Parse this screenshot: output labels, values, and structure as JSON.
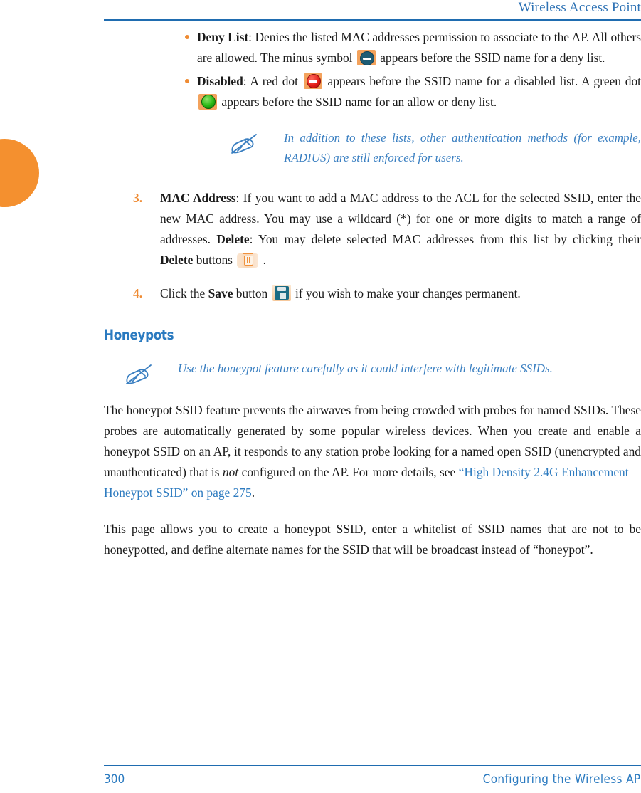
{
  "header": {
    "title": "Wireless Access Point",
    "rule_color": "#1f6cb0"
  },
  "edge_tab": {
    "color": "#f4902f"
  },
  "bullets": [
    {
      "term": "Deny List",
      "text_before": ": Denies the listed MAC addresses permission to associate to the AP. All others are allowed. The minus symbol",
      "icon": "minus-circle-icon",
      "text_after": "appears before the SSID name for a deny list."
    },
    {
      "term": "Disabled",
      "text_before": ": A red dot",
      "icon": "red-dot-icon",
      "text_mid": "appears before the SSID name for a disabled list. A green dot",
      "icon2": "green-dot-icon",
      "text_after": "appears before the SSID name for an allow or deny list."
    }
  ],
  "note_one": {
    "icon": "note-pen-icon",
    "text": "In addition to these lists, other authentication methods (for example, RADIUS) are still enforced for users."
  },
  "steps": [
    {
      "number": "3.",
      "term": "MAC Address",
      "text_a": ": If you want to add a MAC address to the ACL for the selected SSID, enter the new MAC address. You may use a wildcard (*) for one or more digits to match a range of addresses.",
      "term2": "Delete",
      "text_b": ": You may delete selected MAC addresses from this list by clicking their",
      "term3": "Delete",
      "text_c": "buttons",
      "icon": "trash-icon",
      "text_d": "."
    },
    {
      "number": "4.",
      "text_a": "Click the",
      "term": "Save",
      "text_b": "button",
      "icon": "save-disk-icon",
      "text_c": "if you wish to make your changes permanent."
    }
  ],
  "section": {
    "heading": "Honeypots"
  },
  "note_two": {
    "icon": "note-pen-icon",
    "text": "Use the honeypot feature carefully as it could interfere with legitimate SSIDs."
  },
  "paragraphs": {
    "p1_a": "The honeypot SSID feature prevents the airwaves from being crowded with probes for named SSIDs. These probes are automatically generated by some popular wireless devices. When you create and enable a honeypot SSID on an AP, it responds to any station probe looking for a named open SSID (unencrypted and unauthenticated) that is",
    "p1_italic": "not",
    "p1_b": "configured on the AP. For more details, see",
    "p1_link": "“High Density 2.4G Enhancement—Honeypot SSID” on page 275",
    "p1_c": ".",
    "p2": "This page allows you to create a honeypot SSID, enter a whitelist of SSID names that are not to be honeypotted, and define alternate names for the SSID that will be broadcast instead of “honeypot”."
  },
  "footer": {
    "page_number": "300",
    "section_title": "Configuring the Wireless AP"
  },
  "colors": {
    "link_blue": "#2f7cc0",
    "heading_blue": "#2a7ac0",
    "accent_orange": "#ef8b33",
    "note_blue": "#3a7fc1"
  }
}
